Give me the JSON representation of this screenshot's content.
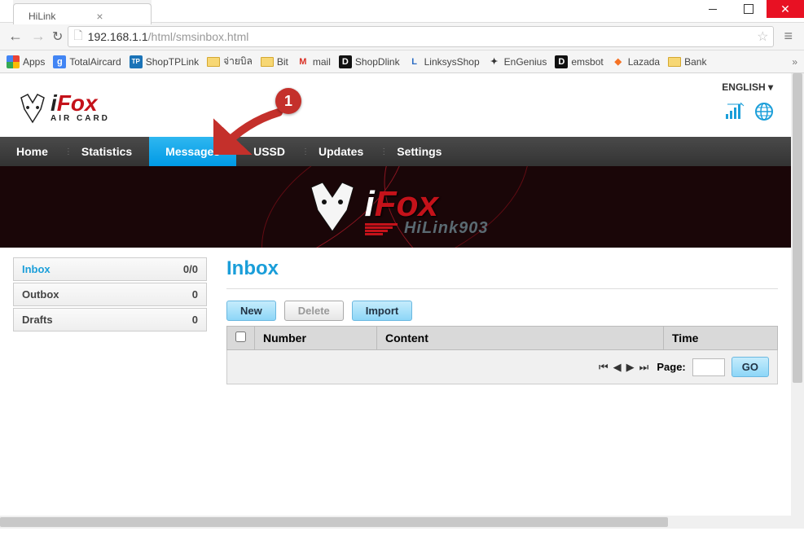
{
  "window": {
    "tab_title": "HiLink",
    "url_host": "192.168.1.1",
    "url_path": "/html/smsinbox.html"
  },
  "bookmarks": {
    "apps_label": "Apps",
    "items": [
      {
        "label": "TotalAircard",
        "icon": "g",
        "color": "#4285f4"
      },
      {
        "label": "ShopTPLink",
        "icon": "TP",
        "color": "#1a73b7"
      },
      {
        "label": "จ่ายบิล",
        "folder": true
      },
      {
        "label": "Bit",
        "folder": true
      },
      {
        "label": "mail",
        "icon": "M",
        "color": "#d93025"
      },
      {
        "label": "ShopDlink",
        "icon": "D",
        "color": "#111"
      },
      {
        "label": "LinksysShop",
        "icon": "L",
        "color": "#2a6cc4"
      },
      {
        "label": "EnGenius",
        "icon": "✦",
        "color": "#333"
      },
      {
        "label": "emsbot",
        "icon": "D",
        "color": "#111"
      },
      {
        "label": "Lazada",
        "icon": "◆",
        "color": "#f57224"
      },
      {
        "label": "Bank",
        "folder": true
      }
    ]
  },
  "header": {
    "brand_i": "i",
    "brand_fox": "Fox",
    "brand_sub": "AIR CARD",
    "language": "ENGLISH ▾"
  },
  "nav": {
    "items": [
      "Home",
      "Statistics",
      "Messages",
      "USSD",
      "Updates",
      "Settings"
    ],
    "active_index": 2
  },
  "banner": {
    "i": "i",
    "fox": "Fox",
    "sub": "HiLink903"
  },
  "sidebar": {
    "items": [
      {
        "label": "Inbox",
        "count": "0/0",
        "active": true
      },
      {
        "label": "Outbox",
        "count": "0",
        "active": false
      },
      {
        "label": "Drafts",
        "count": "0",
        "active": false
      }
    ]
  },
  "main": {
    "title": "Inbox",
    "buttons": {
      "new": "New",
      "delete": "Delete",
      "import": "Import"
    },
    "columns": {
      "number": "Number",
      "content": "Content",
      "time": "Time"
    },
    "pager": {
      "label": "Page:",
      "go": "GO",
      "value": ""
    }
  },
  "annotation": {
    "badge": "1"
  }
}
